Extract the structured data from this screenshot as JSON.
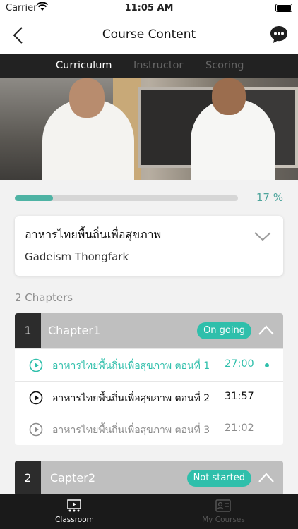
{
  "status_bar": {
    "carrier": "Carrier",
    "time": "11:05 AM"
  },
  "header": {
    "title": "Course Content",
    "back_icon": "chevron-left-icon",
    "chat_icon": "chat-bubble-icon"
  },
  "tabs": [
    {
      "label": "Curriculum",
      "active": true
    },
    {
      "label": "Instructor",
      "active": false
    },
    {
      "label": "Scoring",
      "active": false
    }
  ],
  "progress": {
    "percent": 17,
    "label": "17 %"
  },
  "course": {
    "name": "อาหารไทยพื้นถิ่นเพื่อสุขภาพ",
    "instructor": "Gadeism Thongfark"
  },
  "chapters_count": "2 Chapters",
  "chapters": [
    {
      "number": "1",
      "title": "Chapter1",
      "status": "On going",
      "lessons": [
        {
          "title": "อาหารไทยพื้นถิ่นเพื่อสุขภาพ ตอนที่ 1",
          "duration": "27:00",
          "state": "active"
        },
        {
          "title": "อาหารไทยพื้นถิ่นเพื่อสุขภาพ ตอนที่ 2",
          "duration": "31:57",
          "state": "normal"
        },
        {
          "title": "อาหารไทยพื้นถิ่นเพื่อสุขภาพ ตอนที่ 3",
          "duration": "21:02",
          "state": "muted"
        }
      ]
    },
    {
      "number": "2",
      "title": "Capter2",
      "status": "Not started"
    }
  ],
  "bottom_nav": [
    {
      "label": "Classroom",
      "icon": "classroom-icon",
      "active": true
    },
    {
      "label": "My Courses",
      "icon": "my-courses-icon",
      "active": false
    }
  ],
  "colors": {
    "accent": "#2fbfab",
    "progress": "#4eb3a4",
    "tab_bar": "#222222",
    "chapter_number_bg": "#2c2c2c"
  }
}
